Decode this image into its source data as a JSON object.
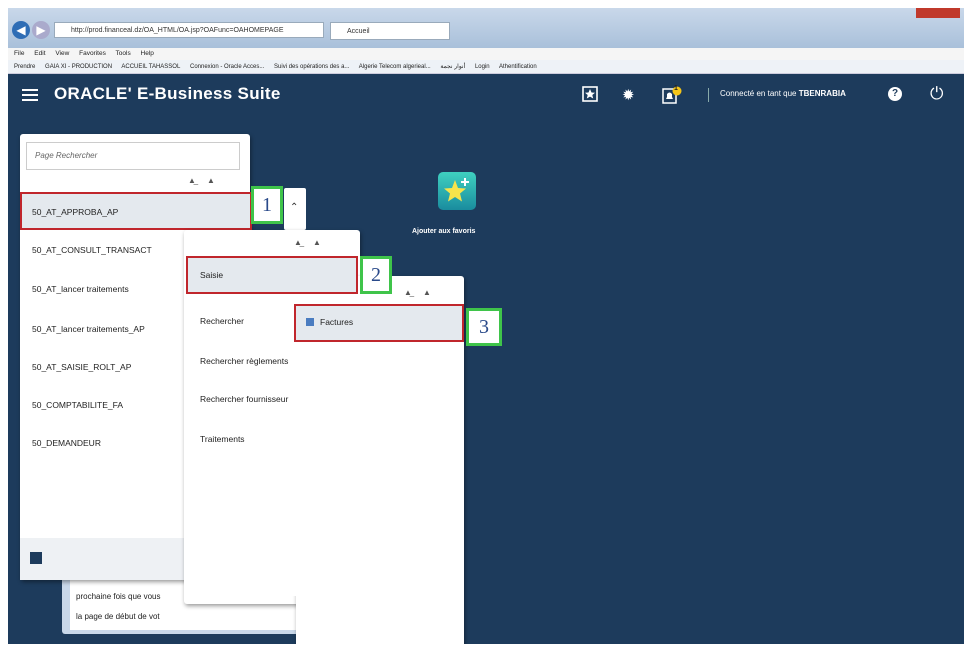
{
  "browser": {
    "address": "http://prod.financeal.dz/OA_HTML/OA.jsp?OAFunc=OAHOMEPAGE",
    "tab_title": "Accueil",
    "menu": [
      "File",
      "Edit",
      "View",
      "Favorites",
      "Tools",
      "Help"
    ],
    "favorites": [
      "Prendre",
      "GAIA XI - PRODUCTION",
      "ACCUEIL TAHASSOL",
      "Connexion - Oracle Acces...",
      "Suivi des opérations des a...",
      "Algerie Telecom algerieal...",
      "أنوار نجمة",
      "Login",
      "Athentification"
    ]
  },
  "header": {
    "app_title": "ORACLE' E-Business Suite",
    "login_prefix": "Connecté en tant que",
    "user": "TBENRABIA",
    "notification_count": "1"
  },
  "favorites_tile": {
    "label": "Ajouter aux favoris"
  },
  "panel1": {
    "search_placeholder": "Page Rechercher",
    "items": [
      "50_AT_APPROBA_AP",
      "50_AT_CONSULT_TRANSACT",
      "50_AT_lancer traitements",
      "50_AT_lancer traitements_AP",
      "50_AT_SAISIE_ROLT_AP",
      "50_COMPTABILITE_FA",
      "50_DEMANDEUR"
    ]
  },
  "panel2": {
    "items": [
      "Saisie",
      "Rechercher",
      "Rechercher règlements",
      "Rechercher fournisseur",
      "Traitements"
    ]
  },
  "panel3": {
    "items": [
      "Factures"
    ]
  },
  "background_text": {
    "line1": "prochaine fois que vous",
    "line2": "la page de début de vot"
  },
  "callouts": [
    "1",
    "2",
    "3"
  ],
  "colors": {
    "header_bg": "#1d3b5c",
    "highlight_border": "#c0262c",
    "callout_border": "#3fc44a"
  }
}
